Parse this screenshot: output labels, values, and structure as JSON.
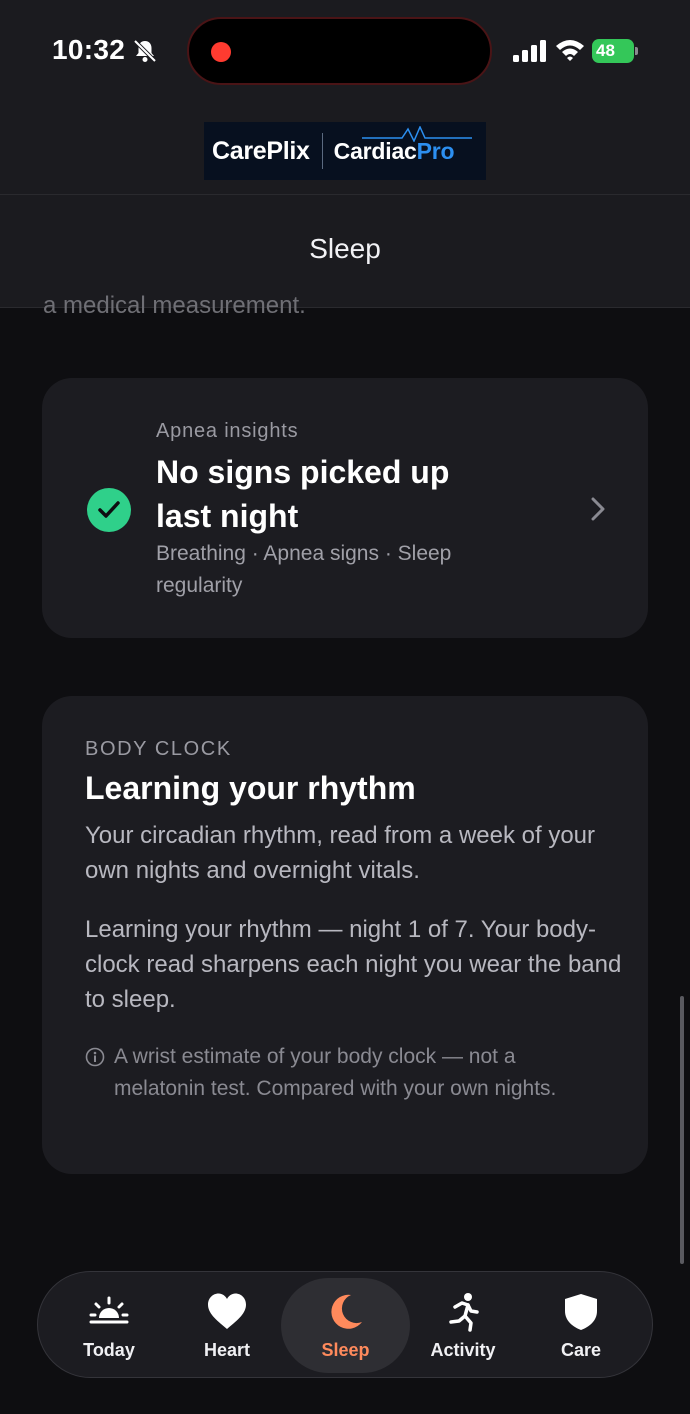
{
  "status_bar": {
    "time": "10:32",
    "battery": "48",
    "icons": [
      "bell-slash-icon",
      "recording-dot-icon",
      "signal-icon",
      "wifi-icon",
      "battery-icon"
    ]
  },
  "brand": {
    "left": "CarePlix",
    "right_main": "Cardiac",
    "right_accent": "Pro"
  },
  "header": {
    "title": "Sleep"
  },
  "clipped_text": "a medical measurement.",
  "apnea_card": {
    "eyebrow": "Apnea insights",
    "title": "No signs picked up last night",
    "subtitle": "Breathing · Apnea signs · Sleep regularity",
    "status_color": "#2fd08a"
  },
  "body_clock_card": {
    "eyebrow": "BODY CLOCK",
    "title": "Learning your rhythm",
    "description": "Your circadian rhythm, read from a week of your own nights and overnight vitals.",
    "progress_text": "Learning your rhythm — night 1 of 7. Your body-clock read sharpens each night you wear the band to sleep.",
    "note": "A wrist estimate of your body clock — not a melatonin test. Compared with your own nights."
  },
  "tabbar": {
    "active": "Sleep",
    "accent_color": "#ff8a5c",
    "tabs": [
      {
        "label": "Today",
        "icon": "sunrise-icon"
      },
      {
        "label": "Heart",
        "icon": "heart-icon"
      },
      {
        "label": "Sleep",
        "icon": "moon-icon"
      },
      {
        "label": "Activity",
        "icon": "running-icon"
      },
      {
        "label": "Care",
        "icon": "shield-icon"
      }
    ]
  }
}
